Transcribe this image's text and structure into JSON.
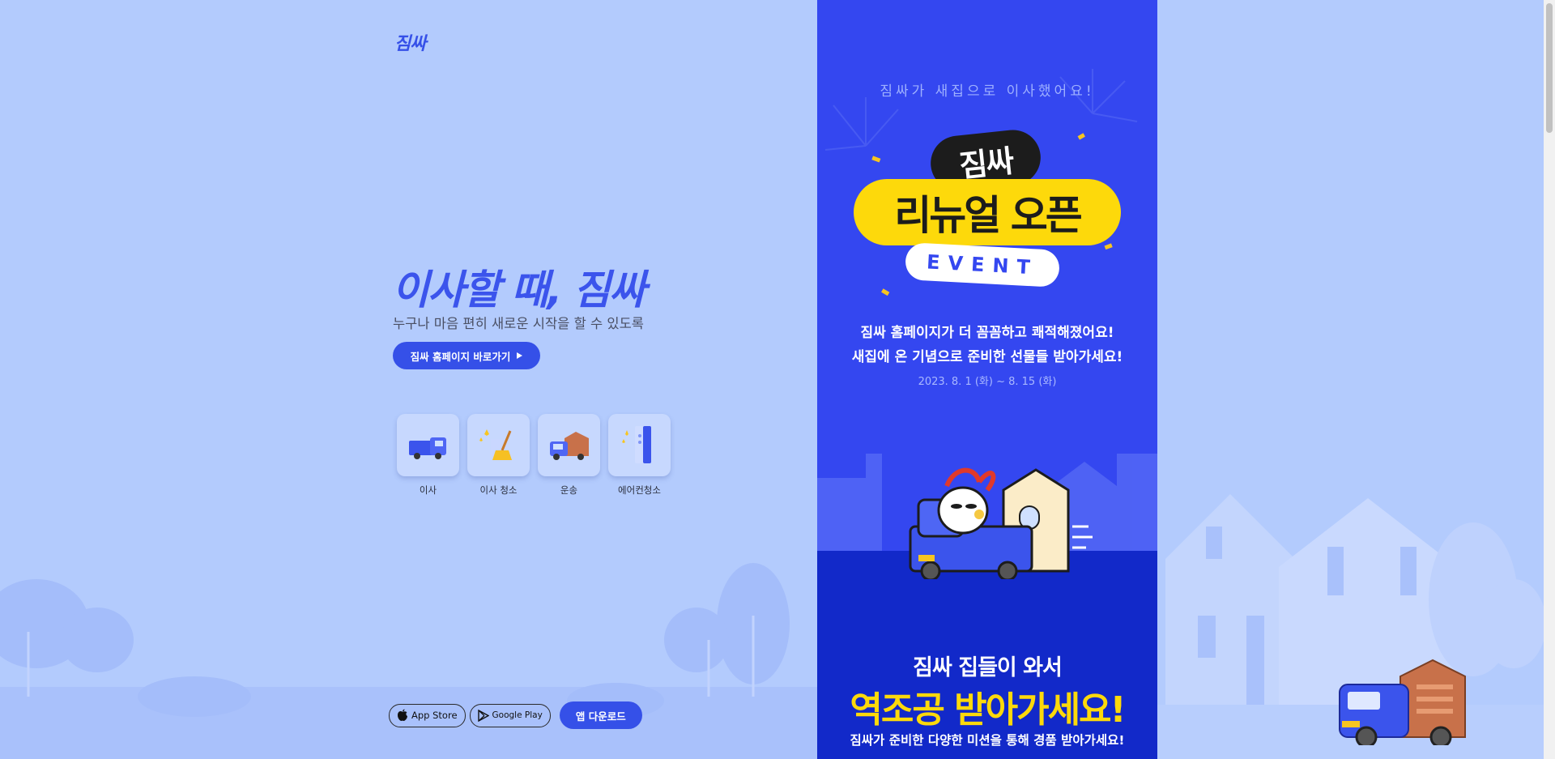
{
  "brand": {
    "logo_text": "짐싸"
  },
  "hero": {
    "title": "이사할 때, 짐싸",
    "subtitle": "누구나 마음 편히 새로운 시작을 할 수 있도록",
    "cta_label": "짐싸 홈페이지 바로가기"
  },
  "services": [
    {
      "label": "이사",
      "icon": "moving-truck-icon"
    },
    {
      "label": "이사 청소",
      "icon": "cleaning-broom-icon"
    },
    {
      "label": "운송",
      "icon": "delivery-truck-icon"
    },
    {
      "label": "에어컨청소",
      "icon": "air-conditioner-icon"
    }
  ],
  "app": {
    "app_store_label": "App Store",
    "google_play_label": "Google Play",
    "download_label": "앱 다운로드"
  },
  "event": {
    "moved_text": "짐싸가 새집으로 이사했어요!",
    "badge_brand": "짐싸",
    "badge_main": "리뉴얼 오픈",
    "badge_event": "EVENT",
    "desc_line1": "짐싸 홈페이지가 더 꼼꼼하고 쾌적해졌어요!",
    "desc_line2": "새집에 온 기념으로 준비한 선물들 받아가세요!",
    "date_range": "2023. 8. 1 (화) ~ 8. 15 (화)",
    "mission_line1": "짐싸 집들이 와서",
    "mission_line2": "역조공 받아가세요!",
    "mission_line3": "짐싸가 준비한 다양한 미션을 통해 경품 받아가세요!"
  },
  "colors": {
    "page_bg": "#b3cbfd",
    "brand_blue": "#3550e8",
    "banner_blue": "#3447f0",
    "banner_dark": "#1229c9",
    "accent_yellow": "#fdd90b"
  }
}
